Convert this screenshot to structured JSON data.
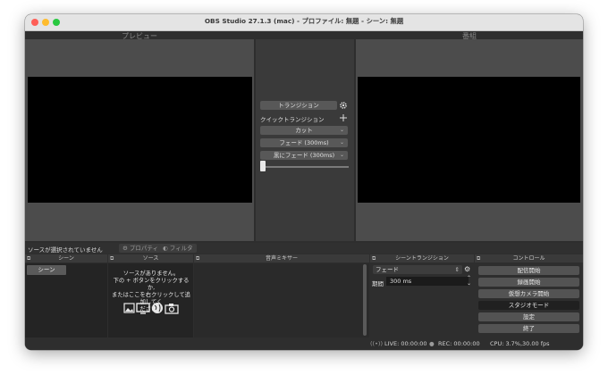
{
  "window": {
    "title": "OBS Studio 27.1.3 (mac) - プロファイル: 無題 - シーン: 無題"
  },
  "preview": {
    "label": "プレビュー"
  },
  "program": {
    "label": "番組"
  },
  "transition": {
    "button_label": "トランジション",
    "quick_label": "クイックトランジション",
    "items": [
      "カット",
      "フェード (300ms)",
      "黒にフェード (300ms)"
    ]
  },
  "source_toolbar": {
    "no_source_text": "ソースが選択されていません",
    "properties_label": "プロパティ",
    "filters_label": "フィルタ"
  },
  "docks": {
    "scenes": {
      "title": "シーン",
      "items": [
        "シーン"
      ]
    },
    "sources": {
      "title": "ソース",
      "empty_lines": [
        "ソースがありません。",
        "下の + ボタンをクリックするか,",
        "またはここを右クリックして追加してく",
        "ださい。"
      ]
    },
    "mixer": {
      "title": "音声ミキサー"
    },
    "scene_transitions": {
      "title": "シーントランジション",
      "selected": "フェード",
      "duration_label": "期間",
      "duration_value": "300 ms"
    },
    "controls": {
      "title": "コントロール",
      "buttons": [
        "配信開始",
        "録画開始",
        "仮想カメラ開始",
        "スタジオモード",
        "設定",
        "終了"
      ]
    }
  },
  "statusbar": {
    "live": "LIVE: 00:00:00",
    "rec": "REC: 00:00:00",
    "cpu": "CPU: 3.7%,30.00 fps"
  },
  "colors": {
    "window_bg": "#2e2e2e",
    "panel_bg": "#4c4c4c",
    "button_bg": "#535353",
    "active_button_bg": "#202020"
  }
}
